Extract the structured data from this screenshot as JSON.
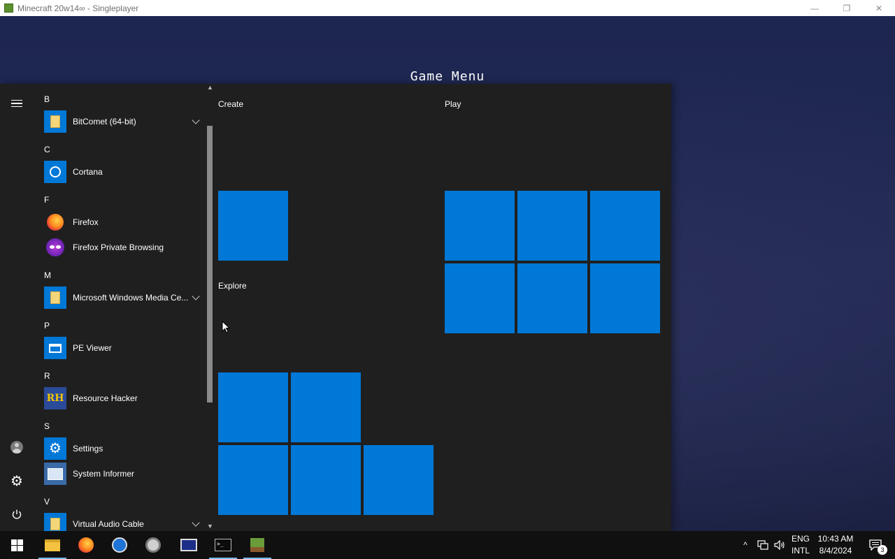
{
  "window": {
    "title": "Minecraft 20w14∞ - Singleplayer",
    "controls": {
      "minimize": "—",
      "restore": "❐",
      "close": "✕"
    }
  },
  "game": {
    "menu_title": "Game Menu"
  },
  "start_menu": {
    "rail": {
      "menu_icon": "hamburger-icon",
      "account_icon": "avatar-icon",
      "settings_icon": "gear-icon",
      "power_icon": "power-icon"
    },
    "letters": {
      "b": "B",
      "c": "C",
      "f": "F",
      "m": "M",
      "p": "P",
      "r": "R",
      "s": "S",
      "v": "V"
    },
    "apps": {
      "bitcomet": "BitComet (64-bit)",
      "cortana": "Cortana",
      "firefox": "Firefox",
      "firefox_private": "Firefox Private Browsing",
      "media_center": "Microsoft Windows Media Ce...",
      "pe_viewer": "PE Viewer",
      "resource_hacker": "Resource Hacker",
      "resource_hacker_icon_text": "RH",
      "settings": "Settings",
      "system_informer": "System Informer",
      "virtual_audio_cable": "Virtual Audio Cable"
    },
    "groups": {
      "create": "Create",
      "play": "Play",
      "explore": "Explore"
    },
    "colors": {
      "tile": "#0078d7",
      "panel": "#1f1f1f"
    }
  },
  "taskbar": {
    "terminal_glyph": ">_",
    "tray": {
      "chevron": "^",
      "network_icon": "network-icon",
      "volume_icon": "volume-icon",
      "lang_top": "ENG",
      "lang_bottom": "INTL",
      "time": "10:43 AM",
      "date": "8/4/2024",
      "notification_count": "3"
    }
  }
}
